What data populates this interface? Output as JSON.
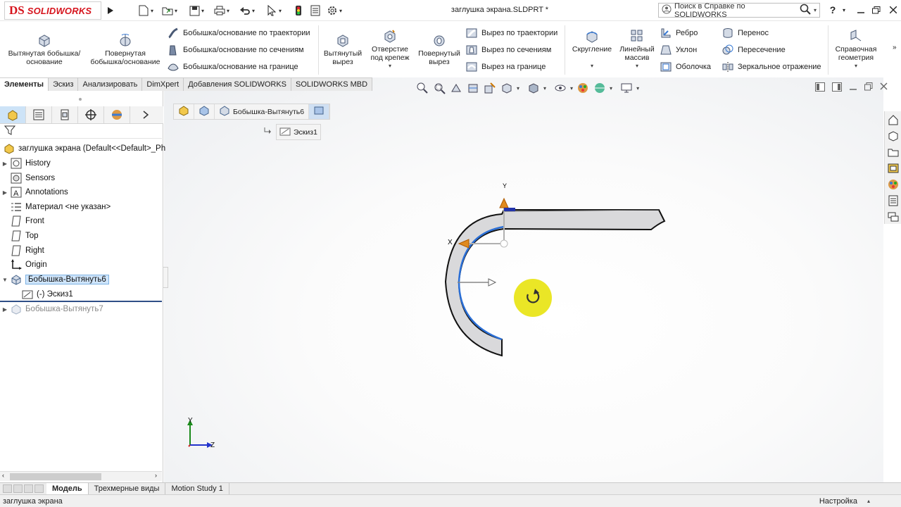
{
  "app": {
    "brand": "SOLIDWORKS",
    "brand_mark": "DS",
    "doc_title": "заглушка экрана.SLDPRT *"
  },
  "help": {
    "placeholder": "Поиск в Справке по SOLIDWORKS"
  },
  "commands": {
    "extruded_boss": "Вытянутая бобышка/основание",
    "revolved_boss": "Повернутая бобышка/основание",
    "swept_boss": "Бобышка/основание по траектории",
    "lofted_boss": "Бобышка/основание по сечениям",
    "boundary_boss": "Бобышка/основание на границе",
    "extruded_cut": "Вытянутый вырез",
    "hole_wizard": "Отверстие под крепеж",
    "revolved_cut": "Повернутый вырез",
    "swept_cut": "Вырез по траектории",
    "lofted_cut": "Вырез по сечениям",
    "boundary_cut": "Вырез на границе",
    "fillet": "Скругление",
    "linear_pattern": "Линейный массив",
    "rib": "Ребро",
    "draft": "Уклон",
    "shell": "Оболочка",
    "wrap": "Перенос",
    "intersect": "Пересечение",
    "mirror": "Зеркальное отражение",
    "reference_geometry": "Справочная геометрия"
  },
  "tabs": [
    "Элементы",
    "Эскиз",
    "Анализировать",
    "DimXpert",
    "Добавления SOLIDWORKS",
    "SOLIDWORKS MBD"
  ],
  "tree": {
    "root": "заглушка экрана  (Default<<Default>_Ph",
    "items": [
      "History",
      "Sensors",
      "Annotations",
      "Материал <не указан>",
      "Front",
      "Top",
      "Right",
      "Origin",
      "Бобышка-Вытянуть6",
      "(-) Эскиз1",
      "Бобышка-Вытянуть7"
    ]
  },
  "breadcrumb": {
    "feature": "Бобышка-Вытянуть6",
    "sketch": "Эскиз1"
  },
  "triad": {
    "x": "X",
    "y": "Y"
  },
  "view_triad": {
    "y": "Y",
    "z": "Z"
  },
  "bottom_tabs": [
    "Модель",
    "Трехмерные виды",
    "Motion Study 1"
  ],
  "status": {
    "left": "заглушка экрана",
    "right": "Настройка"
  },
  "colors": {
    "accent": "#d6131c",
    "selection": "#cfe5fb",
    "highlight": "#e9e51a"
  }
}
